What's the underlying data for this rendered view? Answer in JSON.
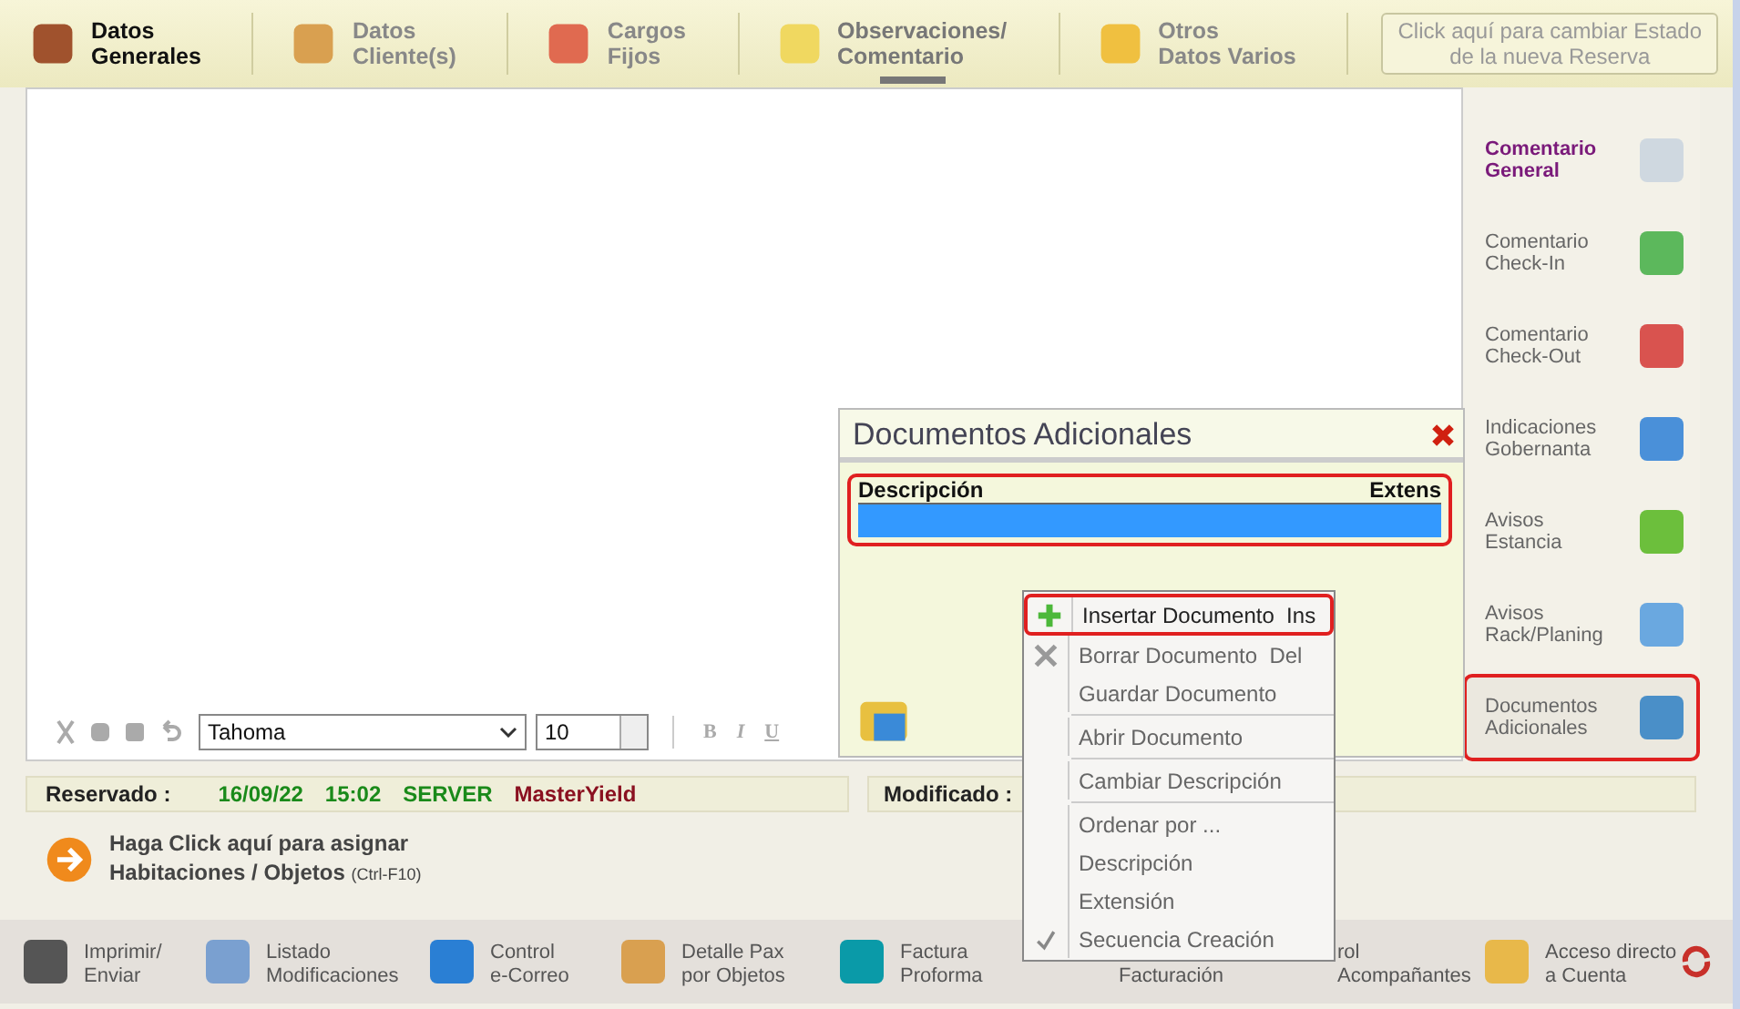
{
  "tabs": [
    {
      "lines": [
        "Datos",
        "Generales"
      ],
      "emphasized": true,
      "selected": false
    },
    {
      "lines": [
        "Datos",
        "Cliente(s)"
      ],
      "emphasized": false,
      "selected": false
    },
    {
      "lines": [
        "Cargos",
        "Fijos"
      ],
      "emphasized": false,
      "selected": false
    },
    {
      "lines": [
        "Observaciones/",
        "Comentario"
      ],
      "emphasized": false,
      "selected": true
    },
    {
      "lines": [
        "Otros",
        "Datos Varios"
      ],
      "emphasized": false,
      "selected": false
    }
  ],
  "state_button": {
    "lines": [
      "Click aquí para cambiar Estado",
      "de la nueva Reserva"
    ]
  },
  "editor_toolbar": {
    "font": "Tahoma",
    "size": "10",
    "format_buttons": [
      "B",
      "I",
      "U"
    ]
  },
  "sidebar": {
    "items": [
      {
        "lines": [
          "Comentario",
          "General"
        ],
        "selected": true,
        "outlined": false
      },
      {
        "lines": [
          "Comentario",
          "Check-In"
        ],
        "selected": false,
        "outlined": false
      },
      {
        "lines": [
          "Comentario",
          "Check-Out"
        ],
        "selected": false,
        "outlined": false
      },
      {
        "lines": [
          "Indicaciones",
          "Gobernanta"
        ],
        "selected": false,
        "outlined": false
      },
      {
        "lines": [
          "Avisos",
          "Estancia"
        ],
        "selected": false,
        "outlined": false
      },
      {
        "lines": [
          "Avisos",
          "Rack/Planing"
        ],
        "selected": false,
        "outlined": false
      },
      {
        "lines": [
          "Documentos",
          "Adicionales"
        ],
        "selected": false,
        "outlined": true
      }
    ]
  },
  "documents_panel": {
    "title": "Documentos Adicionales",
    "columns": [
      "Descripción",
      "Extens"
    ],
    "rows": [
      {
        "selected": true
      }
    ]
  },
  "context_menu": {
    "items": [
      {
        "label": "Insertar Documento",
        "shortcut": "Ins",
        "selected": true,
        "checked": false,
        "separator_before": false
      },
      {
        "label": "Borrar Documento",
        "shortcut": "Del",
        "selected": false,
        "checked": false,
        "separator_before": false
      },
      {
        "label": "Guardar Documento",
        "selected": false,
        "checked": false,
        "separator_before": false
      },
      {
        "label": "Abrir Documento",
        "selected": false,
        "checked": false,
        "separator_before": true
      },
      {
        "label": "Cambiar Descripción",
        "selected": false,
        "checked": false,
        "separator_before": true
      },
      {
        "label": "Ordenar por ...",
        "selected": false,
        "checked": false,
        "separator_before": true
      },
      {
        "label": "Descripción",
        "selected": false,
        "checked": false,
        "separator_before": false
      },
      {
        "label": "Extensión",
        "selected": false,
        "checked": false,
        "separator_before": false
      },
      {
        "label": "Secuencia Creación",
        "selected": false,
        "checked": true,
        "separator_before": false
      }
    ]
  },
  "status_bar": {
    "reserved_label": "Reservado :",
    "date": "16/09/22",
    "time": "15:02",
    "server": "SERVER",
    "user": "MasterYield",
    "modified_label": "Modificado :"
  },
  "assign_link": {
    "line1": "Haga Click aquí para asignar",
    "line2": "Habitaciones / Objetos",
    "shortcut": "(Ctrl-F10)"
  },
  "bottom_toolbar": [
    {
      "lines": [
        "Imprimir/",
        "Enviar"
      ]
    },
    {
      "lines": [
        "Listado",
        "Modificaciones"
      ]
    },
    {
      "lines": [
        "Control",
        "e-Correo"
      ]
    },
    {
      "lines": [
        "Detalle Pax",
        "por Objetos"
      ]
    },
    {
      "lines": [
        "Factura",
        "Proforma"
      ]
    },
    {
      "lines": [
        "Facturación"
      ]
    },
    {
      "lines": [
        "rol",
        "Acompañantes"
      ]
    },
    {
      "lines": [
        "Acceso directo",
        "a Cuenta"
      ]
    }
  ]
}
